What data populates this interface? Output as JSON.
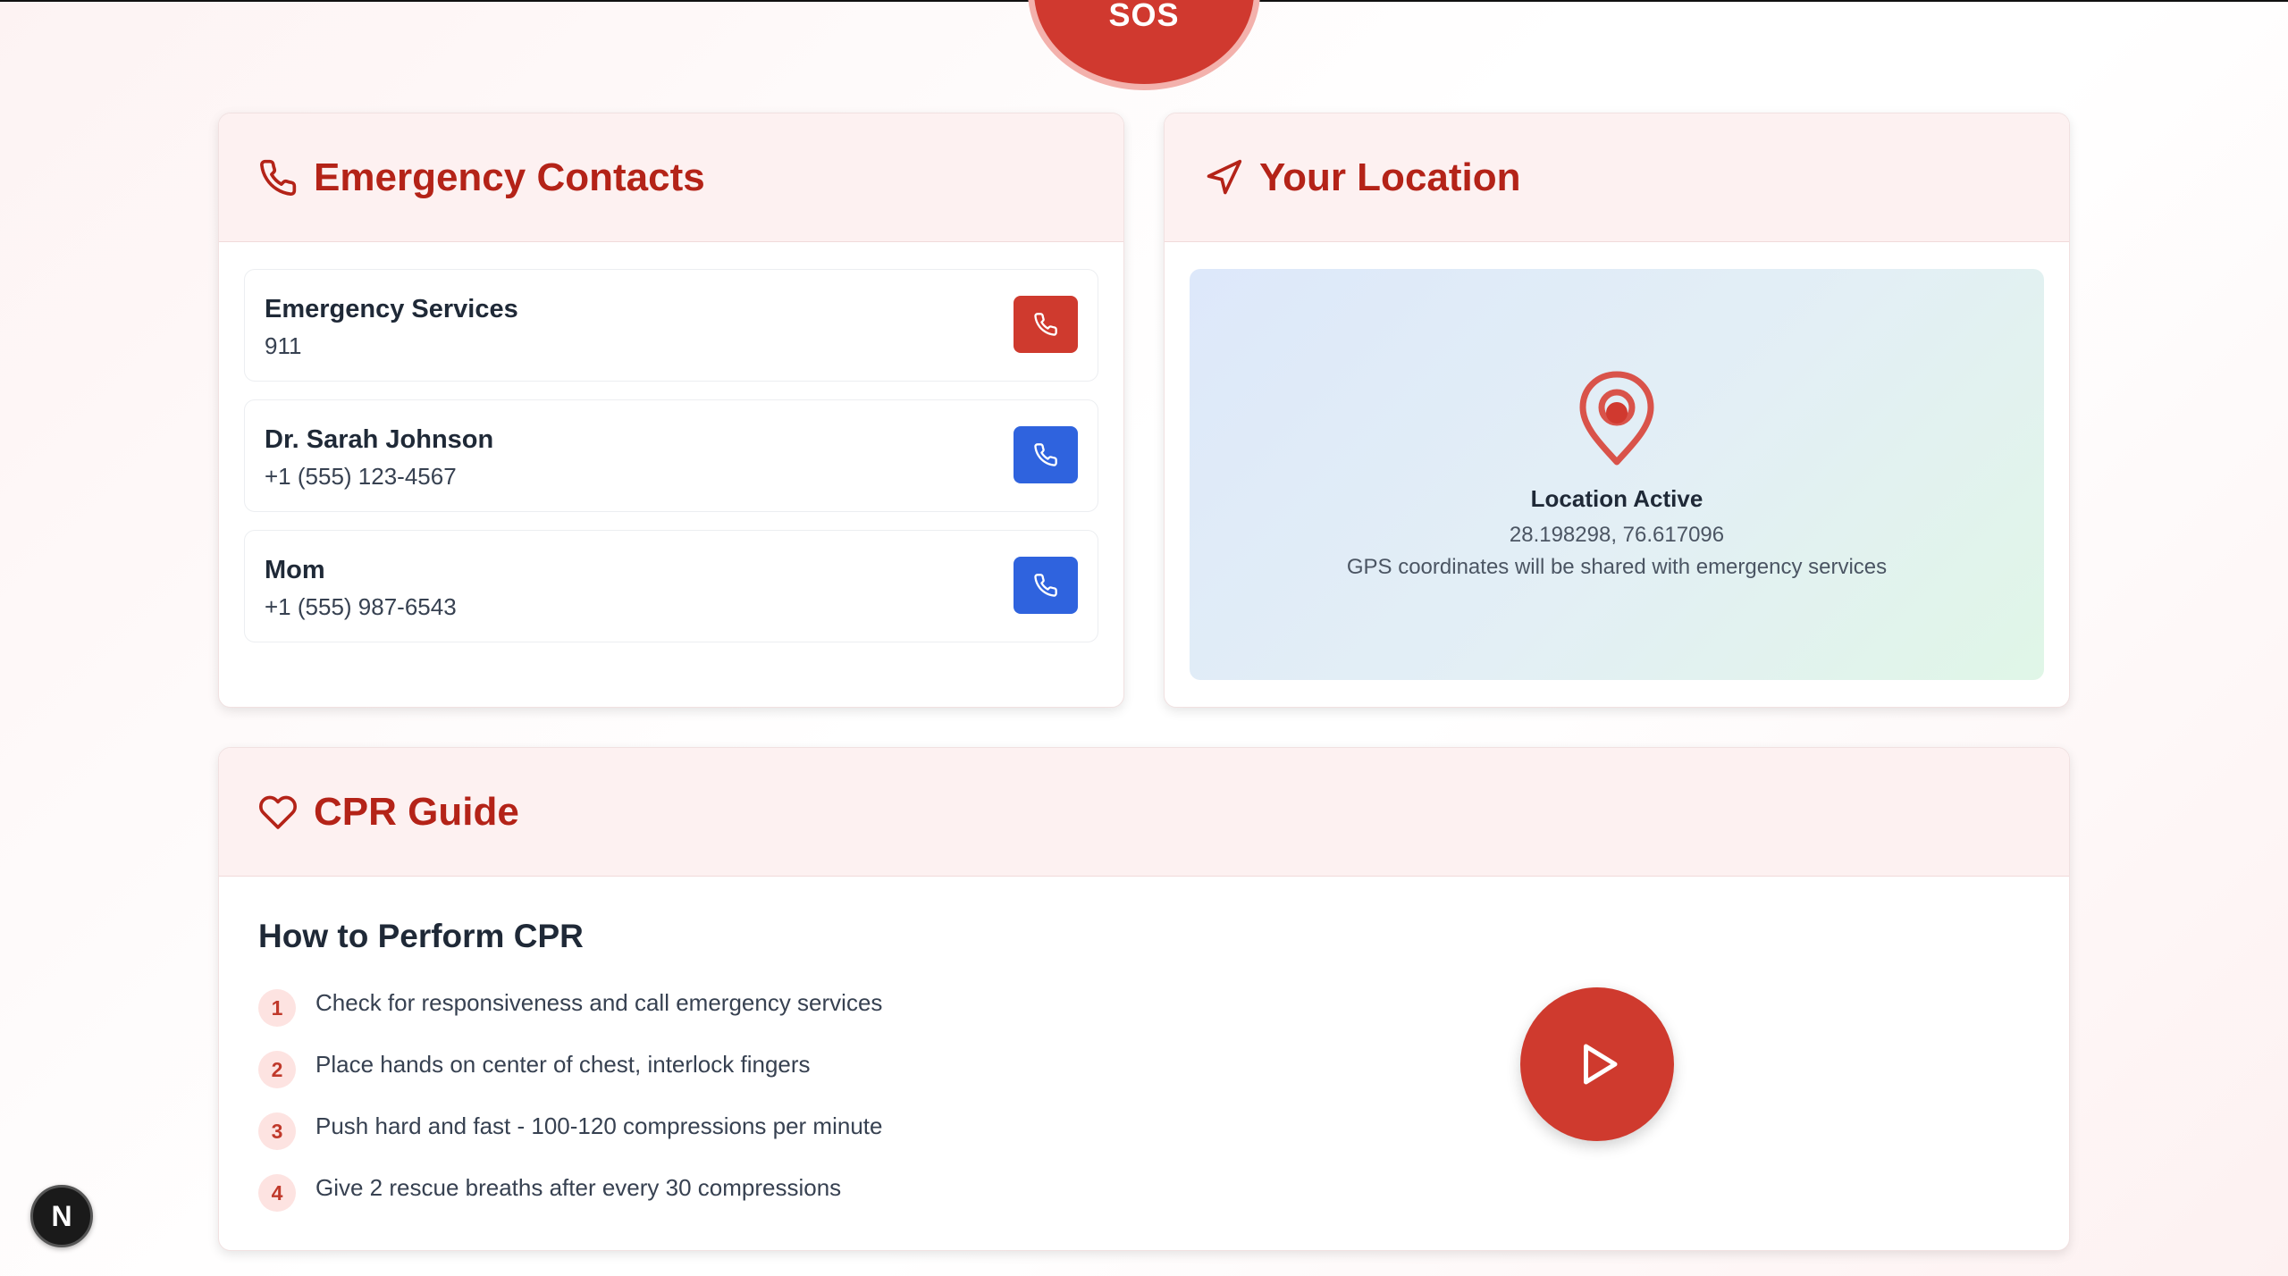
{
  "sos": {
    "label": "SOS"
  },
  "contacts": {
    "title": "Emergency Contacts",
    "items": [
      {
        "name": "Emergency Services",
        "number": "911",
        "button_color": "#cf3a2e"
      },
      {
        "name": "Dr. Sarah Johnson",
        "number": "+1 (555) 123-4567",
        "button_color": "#2f63de"
      },
      {
        "name": "Mom",
        "number": "+1 (555) 987-6543",
        "button_color": "#2f63de"
      }
    ]
  },
  "location": {
    "title": "Your Location",
    "status": "Location Active",
    "coords": "28.198298, 76.617096",
    "note": "GPS coordinates will be shared with emergency services"
  },
  "cpr": {
    "title": "CPR Guide",
    "subtitle": "How to Perform CPR",
    "steps": [
      {
        "num": "1",
        "text": "Check for responsiveness and call emergency services"
      },
      {
        "num": "2",
        "text": "Place hands on center of chest, interlock fingers"
      },
      {
        "num": "3",
        "text": "Push hard and fast - 100-120 compressions per minute"
      },
      {
        "num": "4",
        "text": "Give 2 rescue breaths after every 30 compressions"
      }
    ]
  },
  "dev_badge": {
    "label": "N"
  },
  "colors": {
    "accent": "#b42318",
    "danger": "#cf3a2e",
    "primary": "#2f63de"
  }
}
